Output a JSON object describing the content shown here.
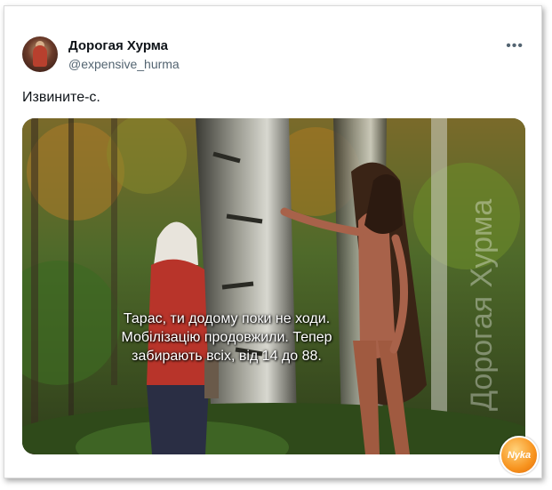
{
  "author": {
    "display_name": "Дорогая Хурма",
    "handle": "@expensive_hurma",
    "avatar_icon": "avatar-icon"
  },
  "menu": {
    "more_label": "•••"
  },
  "tweet": {
    "text": "Извините-с."
  },
  "media": {
    "caption_lines": [
      "Тарас, ти додому поки не ходи.",
      "Мобілізацію продовжили. Тепер",
      "забирають всіх, від 14 до 88."
    ],
    "watermark": "Дорогая Хурма"
  },
  "badge": {
    "text": "Nyka"
  },
  "colors": {
    "name": "#0f1419",
    "handle": "#536471",
    "caption": "#ffffff",
    "badge": "#f7931e"
  }
}
